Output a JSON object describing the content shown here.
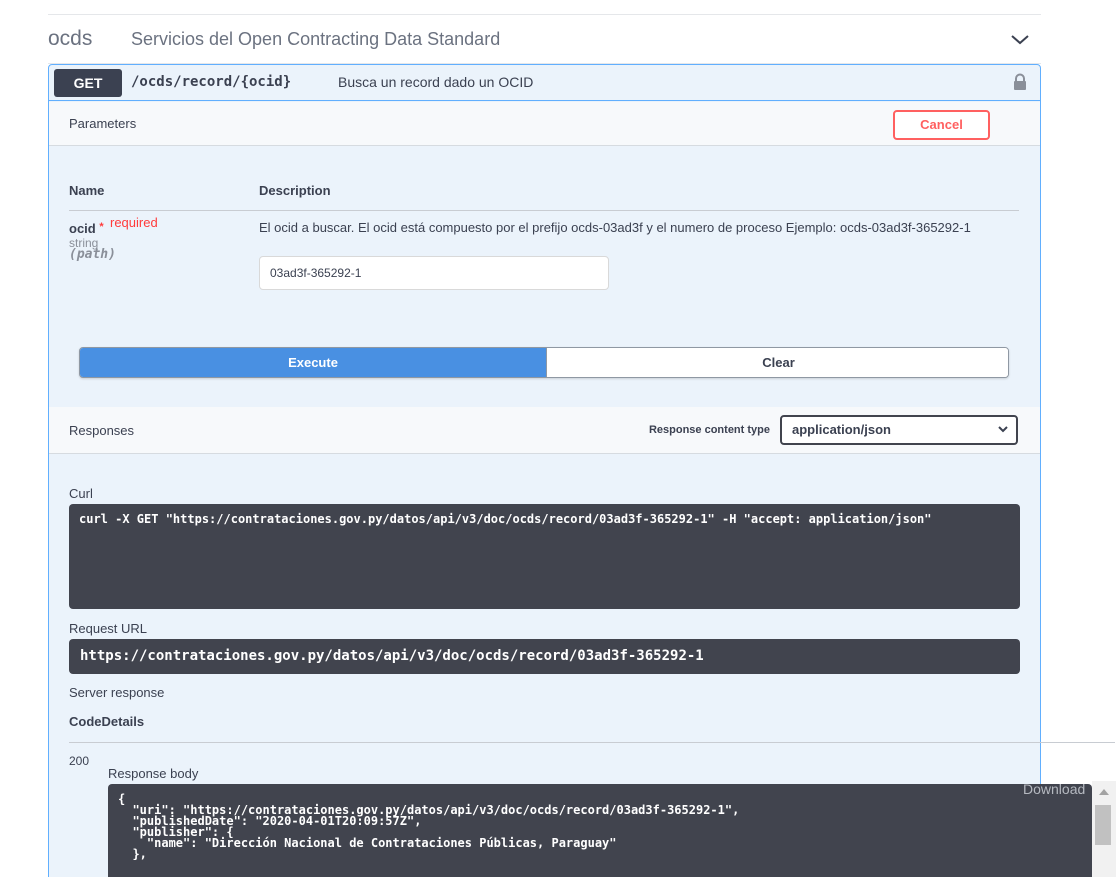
{
  "tag": {
    "name": "ocds",
    "description": "Servicios del Open Contracting Data Standard"
  },
  "operation": {
    "method": "GET",
    "path": "/ocds/record/{ocid}",
    "summary": "Busca un record dado un OCID"
  },
  "parameters": {
    "title": "Parameters",
    "cancel_label": "Cancel",
    "col_name": "Name",
    "col_description": "Description",
    "items": [
      {
        "name": "ocid",
        "star": "*",
        "required_label": "required",
        "type": "string",
        "in": "(path)",
        "description": "El ocid a buscar. El ocid está compuesto por el prefijo ocds-03ad3f y el numero de proceso Ejemplo: ocds-03ad3f-365292-1",
        "value": "03ad3f-365292-1"
      }
    ]
  },
  "actions": {
    "execute_label": "Execute",
    "clear_label": "Clear"
  },
  "responses": {
    "title": "Responses",
    "content_type_label": "Response content type",
    "content_type_value": "application/json",
    "curl_label": "Curl",
    "curl_command": "curl -X GET \"https://contrataciones.gov.py/datos/api/v3/doc/ocds/record/03ad3f-365292-1\" -H \"accept: application/json\"",
    "request_url_label": "Request URL",
    "request_url": "https://contrataciones.gov.py/datos/api/v3/doc/ocds/record/03ad3f-365292-1",
    "server_response_label": "Server response",
    "code_header": "Code",
    "details_header": "Details",
    "status_code": "200",
    "response_body_label": "Response body",
    "response_body": "{\n  \"uri\": \"https://contrataciones.gov.py/datos/api/v3/doc/ocds/record/03ad3f-365292-1\",\n  \"publishedDate\": \"2020-04-01T20:09:57Z\",\n  \"publisher\": {\n    \"name\": \"Dirección Nacional de Contrataciones Públicas, Paraguay\"\n  },",
    "download_label": "Download"
  },
  "icons": {
    "collapse": "chevron-down-icon",
    "lock": "lock-icon",
    "select_arrow": "chevron-down-icon",
    "scroll_up": "scroll-up-arrow-icon"
  },
  "colors": {
    "get_accent": "#61affe",
    "opblock_bg": "#ebf3fb",
    "execute_blue": "#4990e2",
    "cancel_red": "#ff6060",
    "code_bg": "#41444e"
  }
}
